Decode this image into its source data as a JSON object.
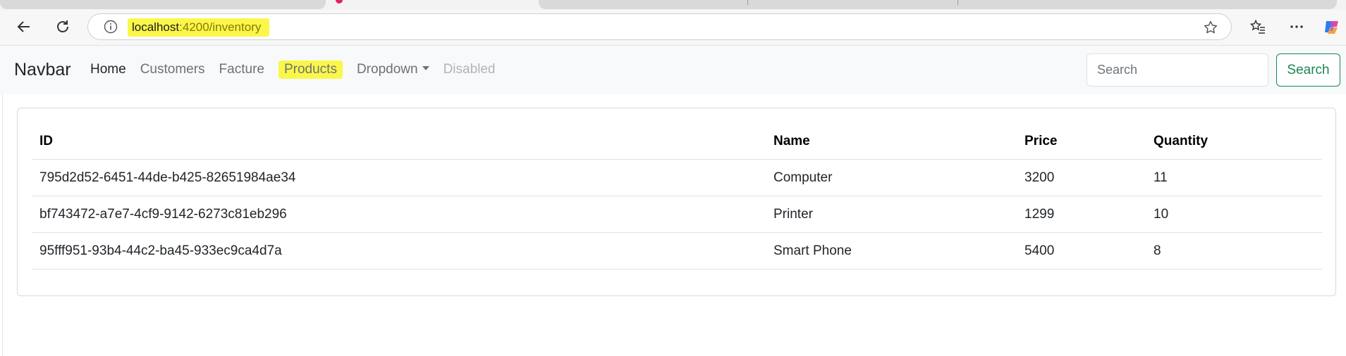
{
  "browser": {
    "url_host": "localhost",
    "url_rest": ":4200/inventory"
  },
  "navbar": {
    "brand": "Navbar",
    "links": [
      {
        "label": "Home"
      },
      {
        "label": "Customers"
      },
      {
        "label": "Facture"
      },
      {
        "label": "Products"
      },
      {
        "label": "Dropdown"
      },
      {
        "label": "Disabled"
      }
    ],
    "search_placeholder": "Search",
    "search_button": "Search"
  },
  "table": {
    "headers": [
      "ID",
      "Name",
      "Price",
      "Quantity"
    ],
    "rows": [
      [
        "795d2d52-6451-44de-b425-82651984ae34",
        "Computer",
        "3200",
        "11"
      ],
      [
        "bf743472-a7e7-4cf9-9142-6273c81eb296",
        "Printer",
        "1299",
        "10"
      ],
      [
        "95fff951-93b4-44c2-ba45-933ec9ca4d7a",
        "Smart Phone",
        "5400",
        "8"
      ]
    ]
  },
  "colors": {
    "highlight": "#fbf74a",
    "success": "#198754",
    "navbar_bg": "#f8f9fa"
  }
}
